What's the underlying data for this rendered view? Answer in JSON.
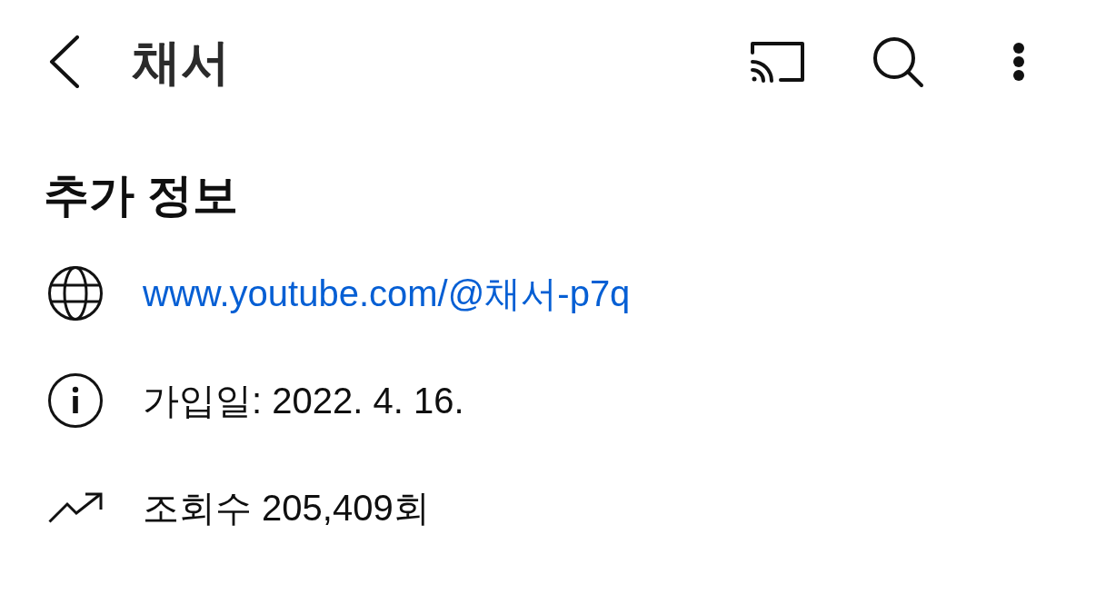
{
  "app_bar": {
    "title": "채서"
  },
  "section": {
    "title": "추가 정보",
    "rows": [
      {
        "kind": "link",
        "text": "www.youtube.com/@채서-p7q"
      },
      {
        "kind": "joined",
        "text": "가입일: 2022. 4. 16."
      },
      {
        "kind": "views",
        "text": "조회수 205,409회"
      }
    ]
  }
}
